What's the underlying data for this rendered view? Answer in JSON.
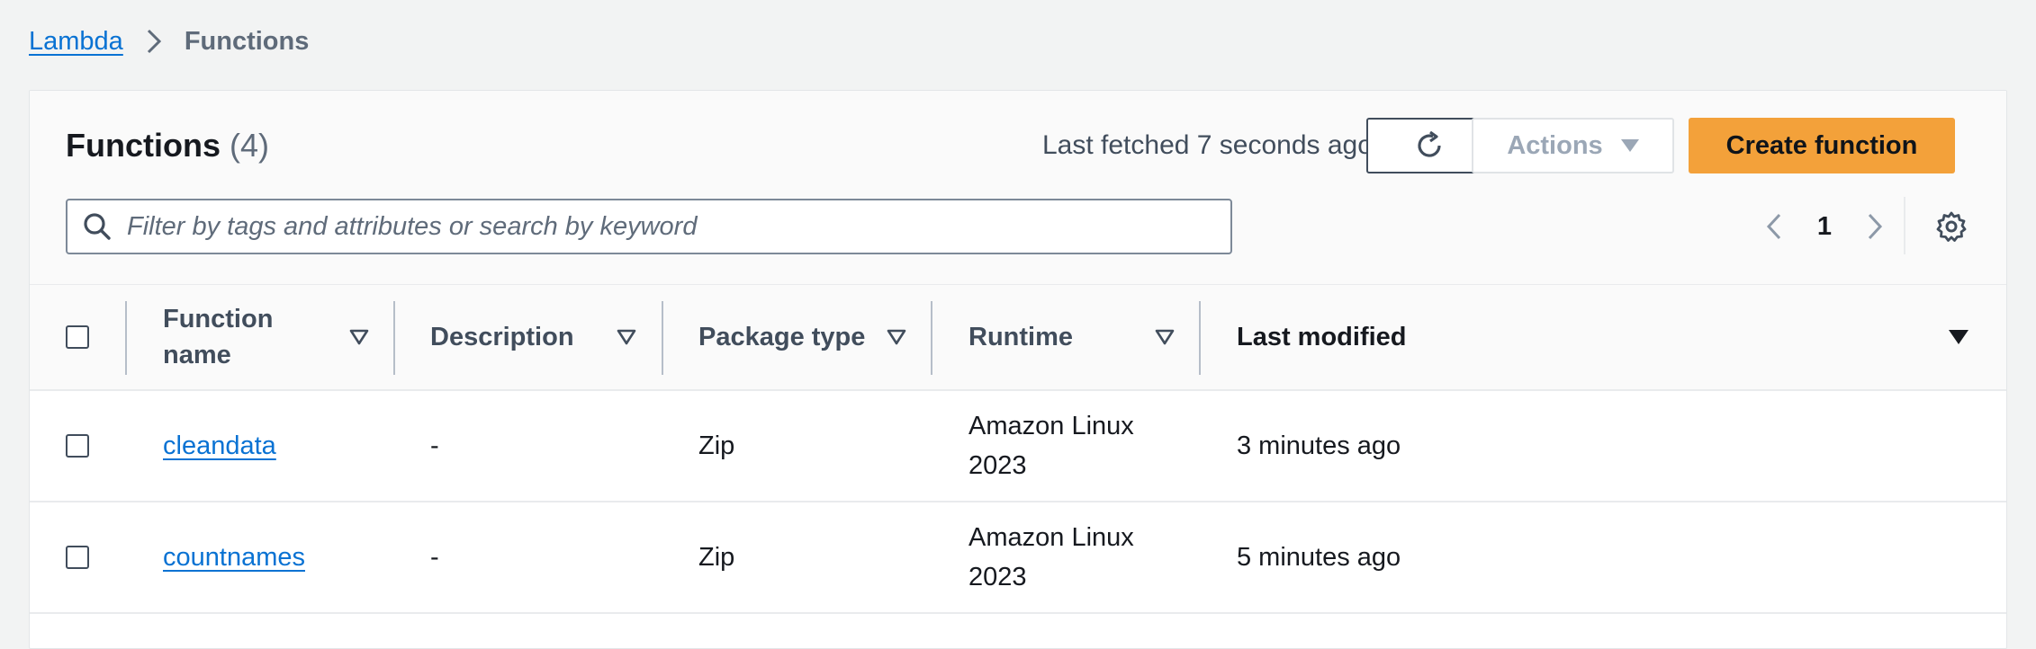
{
  "breadcrumb": {
    "root": "Lambda",
    "current": "Functions"
  },
  "header": {
    "title": "Functions",
    "count": "(4)",
    "last_fetched": "Last fetched 7 seconds ago",
    "actions_label": "Actions",
    "create_label": "Create function"
  },
  "search": {
    "placeholder": "Filter by tags and attributes or search by keyword"
  },
  "pagination": {
    "current_page": "1"
  },
  "table": {
    "columns": [
      "Function name",
      "Description",
      "Package type",
      "Runtime",
      "Last modified"
    ],
    "rows": [
      {
        "name": "cleandata",
        "description": "-",
        "package_type": "Zip",
        "runtime": "Amazon Linux 2023",
        "last_modified": "3 minutes ago"
      },
      {
        "name": "countnames",
        "description": "-",
        "package_type": "Zip",
        "runtime": "Amazon Linux 2023",
        "last_modified": "5 minutes ago"
      }
    ]
  },
  "colors": {
    "link": "#0972d3",
    "primary_button": "#f3a13a",
    "page_background": "#f2f3f3"
  }
}
